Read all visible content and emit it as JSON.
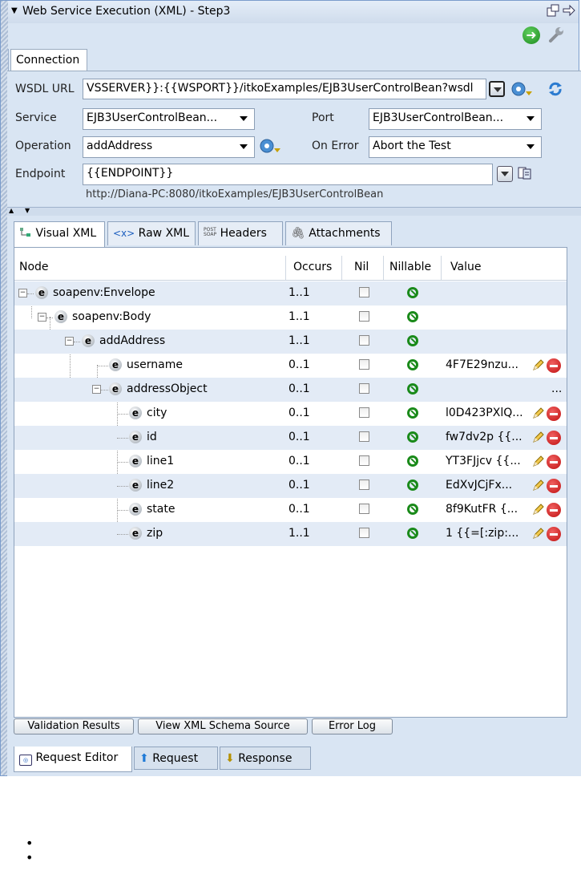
{
  "window": {
    "title": "Web Service Execution (XML) - Step3"
  },
  "connection_tab": "Connection",
  "connection": {
    "wsdl_label": "WSDL URL",
    "wsdl_value": "VSSERVER}}:{{WSPORT}}/itkoExamples/EJB3UserControlBean?wsdl",
    "service_label": "Service",
    "service_value": "EJB3UserControlBean...",
    "port_label": "Port",
    "port_value": "EJB3UserControlBean...",
    "operation_label": "Operation",
    "operation_value": "addAddress",
    "onerror_label": "On Error",
    "onerror_value": "Abort the Test",
    "endpoint_label": "Endpoint",
    "endpoint_value": "{{ENDPOINT}}",
    "endpoint_resolved": "http://Diana-PC:8080/itkoExamples/EJB3UserControlBean"
  },
  "tabs": [
    {
      "label": "Visual XML"
    },
    {
      "label": "Raw XML",
      "prefix": "<x>"
    },
    {
      "label": "Headers",
      "prefix_top": "POST",
      "prefix_bottom": "SOAP"
    },
    {
      "label": "Attachments"
    }
  ],
  "table": {
    "headers": {
      "node": "Node",
      "occurs": "Occurs",
      "nil": "Nil",
      "nillable": "Nillable",
      "value": "Value"
    },
    "icon_letter": "e",
    "rows": [
      {
        "node": "soapenv:Envelope",
        "occurs": "1..1",
        "value": ""
      },
      {
        "node": "soapenv:Body",
        "occurs": "1..1",
        "value": ""
      },
      {
        "node": "addAddress",
        "occurs": "1..1",
        "value": ""
      },
      {
        "node": "username",
        "occurs": "0..1",
        "value": "4F7E29nzu..."
      },
      {
        "node": "addressObject",
        "occurs": "0..1",
        "value": "..."
      },
      {
        "node": "city",
        "occurs": "0..1",
        "value": "l0D423PXlQ..."
      },
      {
        "node": "id",
        "occurs": "0..1",
        "value": "fw7dv2p {{..."
      },
      {
        "node": "line1",
        "occurs": "0..1",
        "value": "YT3FJjcv {{..."
      },
      {
        "node": "line2",
        "occurs": "0..1",
        "value": "EdXvJCjFx..."
      },
      {
        "node": "state",
        "occurs": "0..1",
        "value": "8f9KutFR {..."
      },
      {
        "node": "zip",
        "occurs": "1..1",
        "value": "1 {{=[:zip:..."
      }
    ]
  },
  "bottom_buttons": {
    "validation": "Validation Results",
    "schema": "View XML Schema Source",
    "errorlog": "Error Log"
  },
  "bottom_tabs": {
    "request_editor": "Request Editor",
    "request": "Request",
    "response": "Response"
  },
  "colors": {
    "accent": "#d9e5f3",
    "alt_row": "#e3ebf6",
    "nillable_green": "#1a8a1a",
    "remove_red": "#c01010"
  }
}
